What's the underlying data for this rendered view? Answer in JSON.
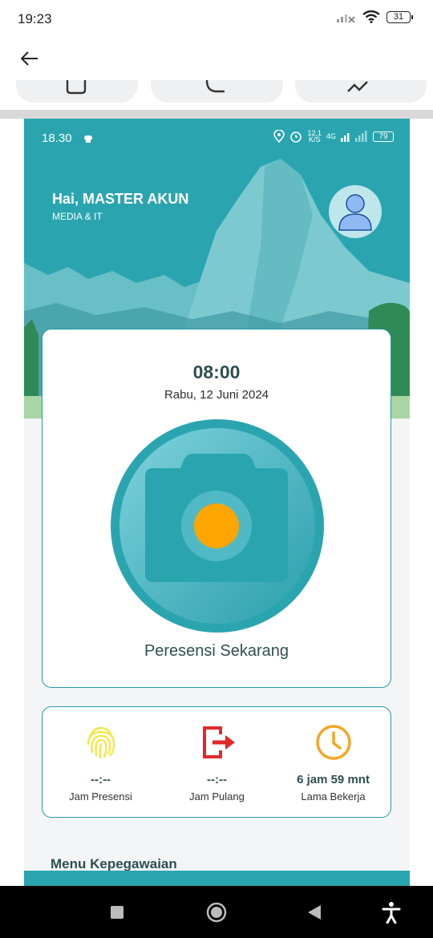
{
  "os_status": {
    "time": "19:23",
    "battery": "31",
    "icons": [
      "signal-off-icon",
      "wifi-icon",
      "battery-icon"
    ]
  },
  "nav": {
    "back_icon": "arrow-left-icon"
  },
  "app": {
    "status": {
      "time": "18.30",
      "speed": "12,1",
      "speed_unit": "K/S",
      "network": "4G",
      "battery": "79"
    },
    "greeting": "Hai, MASTER AKUN",
    "department": "MEDIA & IT",
    "clock": "08:00",
    "date": "Rabu, 12 Juni 2024",
    "camera_label": "Peresensi Sekarang",
    "stats": [
      {
        "value": "--:--",
        "label": "Jam Presensi",
        "icon": "fingerprint-icon"
      },
      {
        "value": "--:--",
        "label": "Jam Pulang",
        "icon": "logout-icon"
      },
      {
        "value": "6 jam 59  mnt",
        "label": "Lama Bekerja",
        "icon": "clock-icon"
      }
    ],
    "menu_title": "Menu Kepegawaian"
  },
  "colors": {
    "teal": "#2aa5b0",
    "orange": "#ffa500",
    "fingerprint": "#f3e84a",
    "logout": "#e02a2a",
    "clock": "#f5a623"
  },
  "navbar": {
    "icons": [
      "square-recent-icon",
      "circle-home-icon",
      "triangle-back-icon",
      "accessibility-icon"
    ]
  }
}
